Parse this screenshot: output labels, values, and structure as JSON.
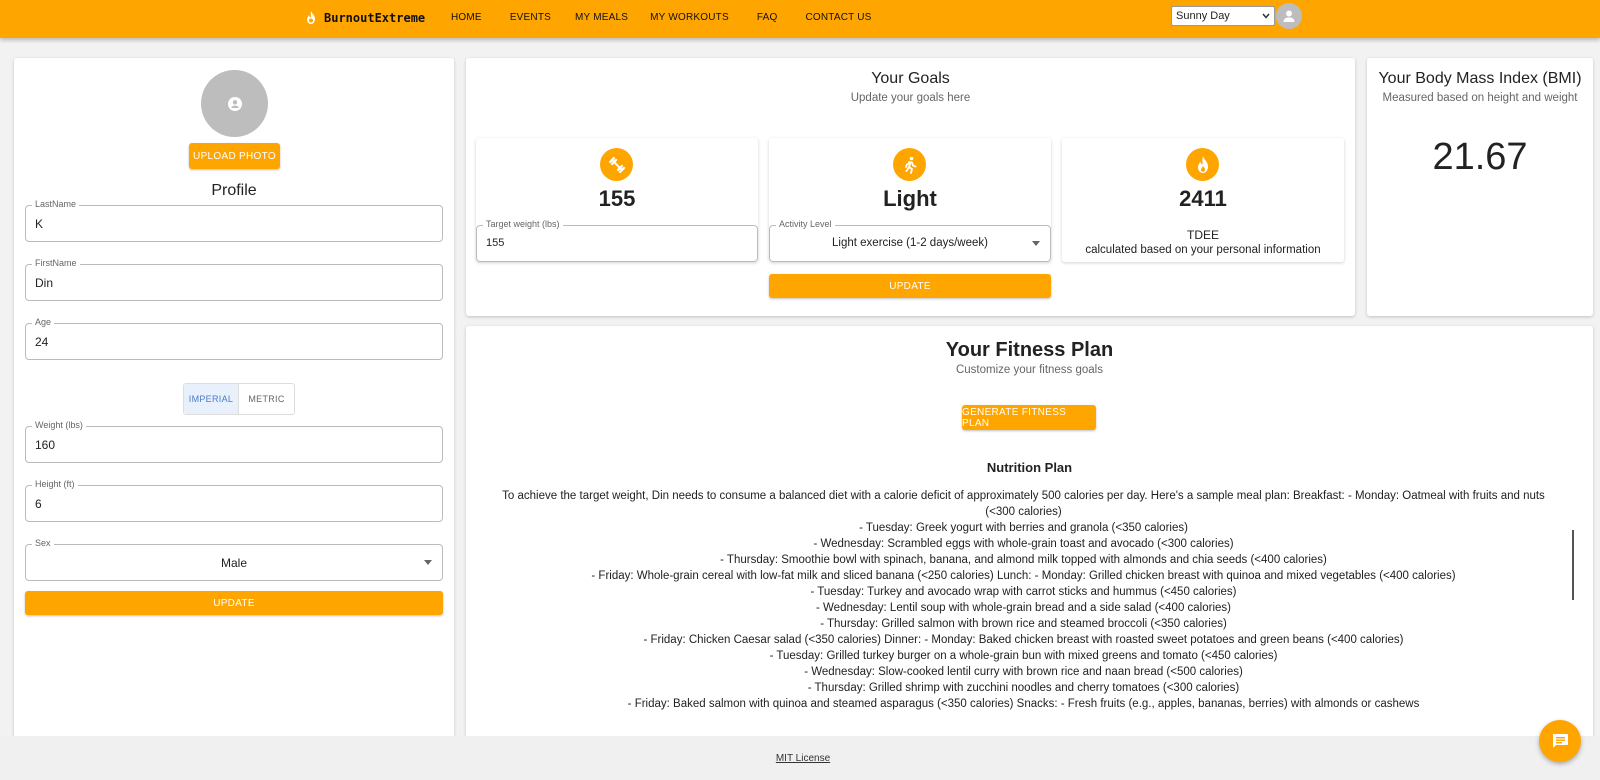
{
  "header": {
    "brand": "BurnoutExtreme",
    "nav": [
      {
        "label": "HOME"
      },
      {
        "label": "EVENTS"
      },
      {
        "label": "MY MEALS"
      },
      {
        "label": "MY WORKOUTS"
      },
      {
        "label": "FAQ"
      },
      {
        "label": "CONTACT US"
      }
    ],
    "theme_selected": "Sunny Day"
  },
  "profile": {
    "upload_label": "UPLOAD PHOTO",
    "title": "Profile",
    "last_name": {
      "label": "LastName",
      "value": "K"
    },
    "first_name": {
      "label": "FirstName",
      "value": "Din"
    },
    "age": {
      "label": "Age",
      "value": "24"
    },
    "units": {
      "imperial": "IMPERIAL",
      "metric": "METRIC",
      "selected": "IMPERIAL"
    },
    "weight": {
      "label": "Weight (lbs)",
      "value": "160"
    },
    "height": {
      "label": "Height (ft)",
      "value": "6"
    },
    "sex": {
      "label": "Sex",
      "value": "Male"
    },
    "update_label": "UPDATE"
  },
  "goals": {
    "title": "Your Goals",
    "subtitle": "Update your goals here",
    "target_weight": {
      "value": "155",
      "label": "Target weight (lbs)",
      "input": "155"
    },
    "activity": {
      "value": "Light",
      "label": "Activity Level",
      "selected": "Light exercise (1-2 days/week)"
    },
    "tdee": {
      "value": "2411",
      "label": "TDEE",
      "note": "calculated based on your personal information"
    },
    "update_label": "UPDATE"
  },
  "bmi": {
    "title": "Your Body Mass Index (BMI)",
    "subtitle": "Measured based on height and weight",
    "value": "21.67"
  },
  "plan": {
    "title": "Your Fitness Plan",
    "subtitle": "Customize your fitness goals",
    "generate_label": "GENERATE FITNESS PLAN",
    "nutrition_heading": "Nutrition Plan",
    "lines": [
      "To achieve the target weight, Din needs to consume a balanced diet with a calorie deficit of approximately 500 calories per day. Here's a sample meal plan: Breakfast: - Monday: Oatmeal with fruits and nuts (<300 calories)",
      "- Tuesday: Greek yogurt with berries and granola (<350 calories)",
      "- Wednesday: Scrambled eggs with whole-grain toast and avocado (<300 calories)",
      "- Thursday: Smoothie bowl with spinach, banana, and almond milk topped with almonds and chia seeds (<400 calories)",
      "- Friday: Whole-grain cereal with low-fat milk and sliced banana (<250 calories) Lunch: - Monday: Grilled chicken breast with quinoa and mixed vegetables (<400 calories)",
      "- Tuesday: Turkey and avocado wrap with carrot sticks and hummus (<450 calories)",
      "- Wednesday: Lentil soup with whole-grain bread and a side salad (<400 calories)",
      "- Thursday: Grilled salmon with brown rice and steamed broccoli (<350 calories)",
      "- Friday: Chicken Caesar salad (<350 calories) Dinner: - Monday: Baked chicken breast with roasted sweet potatoes and green beans (<400 calories)",
      "- Tuesday: Grilled turkey burger on a whole-grain bun with mixed greens and tomato (<450 calories)",
      "- Wednesday: Slow-cooked lentil curry with brown rice and naan bread (<500 calories)",
      "- Thursday: Grilled shrimp with zucchini noodles and cherry tomatoes (<300 calories)",
      "- Friday: Baked salmon with quinoa and steamed asparagus (<350 calories) Snacks: - Fresh fruits (e.g., apples, bananas, berries) with almonds or cashews"
    ]
  },
  "footer": {
    "license": "MIT License"
  },
  "colors": {
    "accent": "#ffa500",
    "header": "#ffa500",
    "avatar": "#bdbdbd"
  }
}
